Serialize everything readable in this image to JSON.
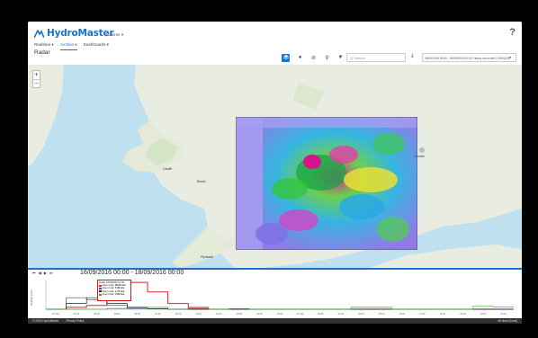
{
  "app": {
    "name": "HydroMaster",
    "account": "| Owner ▾",
    "help": "?"
  },
  "nav": {
    "items": [
      "Realtime ▾",
      "Archive ▾",
      "Dashboards ▾"
    ],
    "active": 1
  },
  "page": {
    "title": "Radar"
  },
  "toolbar": {
    "icons": [
      "layers-icon",
      "pin-icon",
      "link-icon",
      "location-icon",
      "filter-icon"
    ],
    "search_placeholder": "Q Search",
    "download_icon": "download-icon",
    "range_value": "16/09/2016 00:00 - 18/09/2016 00:00: Heavy rain event 17/09/2016",
    "range_caret": "▾"
  },
  "map": {
    "zoom_in": "+",
    "zoom_out": "−",
    "labels": [
      {
        "id": "cardiff",
        "text": "Cardiff"
      },
      {
        "id": "bristol",
        "text": "Bristol"
      },
      {
        "id": "london",
        "text": "London"
      },
      {
        "id": "plymouth",
        "text": "Plymouth"
      }
    ],
    "colors": {
      "sea": "#bfe0ef",
      "land": "#e8ecdf",
      "radar_bg": "#b9b2f0"
    }
  },
  "timebar": {
    "buttons": [
      "⏮",
      "◀",
      "▶",
      "⏭"
    ],
    "timestamp": "16/09/2016 00:00 - 18/09/2016 00:00"
  },
  "chart_data": {
    "type": "bar",
    "ylabel": "Rainfall (mm)",
    "x_ticks": [
      "16 Sep",
      "02:00",
      "04:00",
      "06:00",
      "08:00",
      "10:00",
      "12:00",
      "14:00",
      "16:00",
      "18:00",
      "20:00",
      "22:00",
      "17 Sep",
      "02:00",
      "04:00",
      "06:00",
      "08:00",
      "10:00",
      "12:00",
      "14:00",
      "16:00",
      "18:00",
      "20:00"
    ],
    "series": [
      {
        "name": "Event total",
        "color": "#e32222",
        "values": [
          0,
          1,
          2,
          9,
          14,
          9,
          3,
          0.5,
          0,
          0,
          0,
          0,
          0,
          0,
          0,
          0,
          0,
          0,
          0,
          0,
          0,
          0,
          0
        ]
      },
      {
        "name": "Event total",
        "color": "#2a4fb0",
        "values": [
          0,
          6,
          5,
          2,
          0.5,
          0.3,
          0,
          0,
          0,
          0,
          0,
          0,
          0,
          0,
          0,
          0,
          0,
          0,
          0,
          0,
          0,
          0,
          0
        ]
      },
      {
        "name": "Event total",
        "color": "#222222",
        "values": [
          0,
          3,
          6,
          3,
          1,
          0.3,
          0,
          0,
          0,
          0,
          0,
          0,
          0,
          0,
          0,
          0,
          0,
          0,
          0,
          0,
          0,
          0,
          0
        ]
      },
      {
        "name": "Event total",
        "color": "#3aa83a",
        "values": [
          0,
          0,
          0,
          0.4,
          0.2,
          1,
          0,
          1.2,
          0,
          0.3,
          0,
          0,
          0,
          0,
          0,
          1,
          1,
          0,
          0,
          0,
          0,
          1.5,
          1.2
        ]
      }
    ],
    "ylim": [
      0,
      15
    ]
  },
  "tooltip": {
    "title": "Friday 16/09/2016 07:00",
    "rows": [
      {
        "label": "Event total:",
        "value": "56.00 mm",
        "color": "#e32222"
      },
      {
        "label": "Event total:",
        "value": "5.30 mm",
        "color": "#2a4fb0"
      },
      {
        "label": "Event total:",
        "value": "1.75 mm",
        "color": "#222222"
      },
      {
        "label": "Event total:",
        "value": "0.60 mm",
        "color": "#3aa83a"
      }
    ]
  },
  "footer": {
    "copyright": "© 2016 HydroMaster",
    "privacy": "Privacy Policy",
    "timezone": "All times (local)"
  }
}
